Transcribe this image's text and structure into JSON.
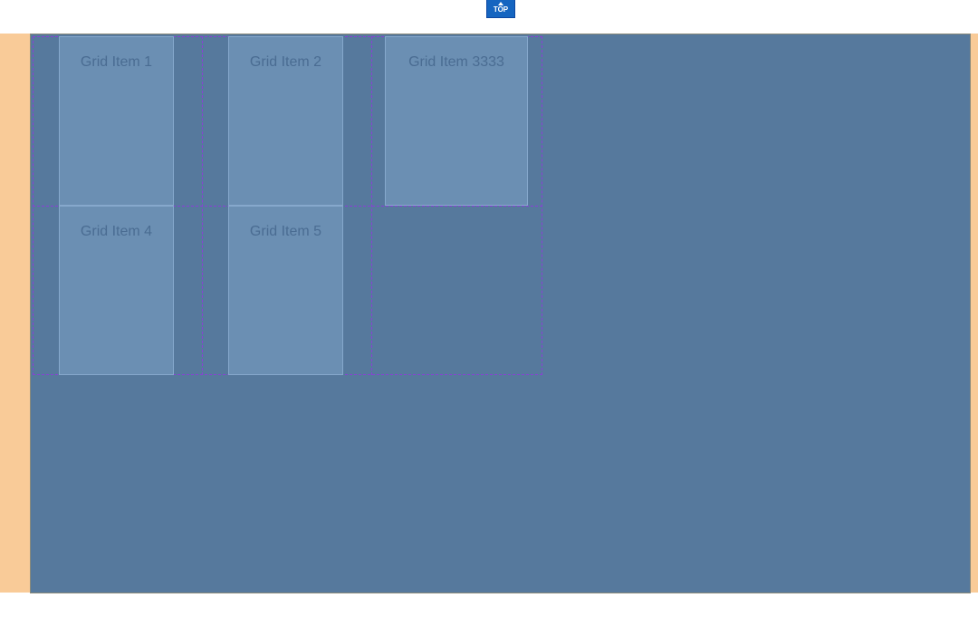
{
  "top_badge": {
    "label": "TOP",
    "icon": "up-arrow-icon"
  },
  "grid": {
    "items": [
      {
        "label": "Grid Item 1"
      },
      {
        "label": "Grid Item 2"
      },
      {
        "label": "Grid Item 3333"
      },
      {
        "label": "Grid Item 4"
      },
      {
        "label": "Grid Item 5"
      }
    ]
  },
  "colors": {
    "margin": "#f9cb98",
    "container": "#56799d",
    "item": "#6b8fb3",
    "grid_line": "#8a3fd6",
    "badge": "#1565c0"
  }
}
